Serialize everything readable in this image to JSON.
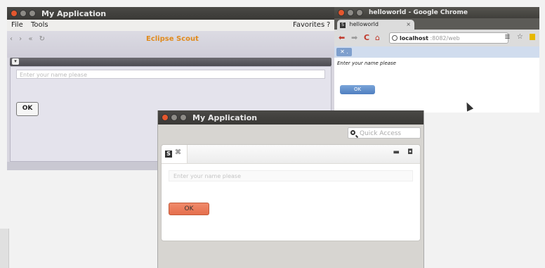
{
  "swing_window": {
    "title": "My Application",
    "menu": {
      "file": "File",
      "tools": "Tools",
      "favorites": "Favorites",
      "help": "?"
    },
    "toolbar_title": "Eclipse Scout",
    "nav_icons": "‹ › « ↻",
    "name_placeholder": "Enter your name please",
    "ok_label": "OK"
  },
  "browser_window": {
    "title": "helloworld - Google Chrome",
    "tab_title": "helloworld",
    "tab_favicon": "S",
    "tab_close": "×",
    "back": "⬅",
    "forward": "➡",
    "reload": "C",
    "home": "⌂",
    "url_host": "localhost",
    "url_path": ":8082/web",
    "toolbar_icons": "≣ ☆",
    "app_tab": "✕ .",
    "name_label": "Enter your name please",
    "ok_label": "OK"
  },
  "rap_window": {
    "title": "My Application",
    "quick_access_placeholder": "Quick Access",
    "part_logo": "S",
    "part_close": "⌘",
    "minimize": "▬",
    "maximize": "◘",
    "name_placeholder": "Enter your name please",
    "ok_label": "OK"
  },
  "colors": {
    "accent_orange": "#e08a1c",
    "rap_ok": "#e56f4d",
    "chrome_ok": "#4f7fc0",
    "close_dot": "#e4572e"
  }
}
